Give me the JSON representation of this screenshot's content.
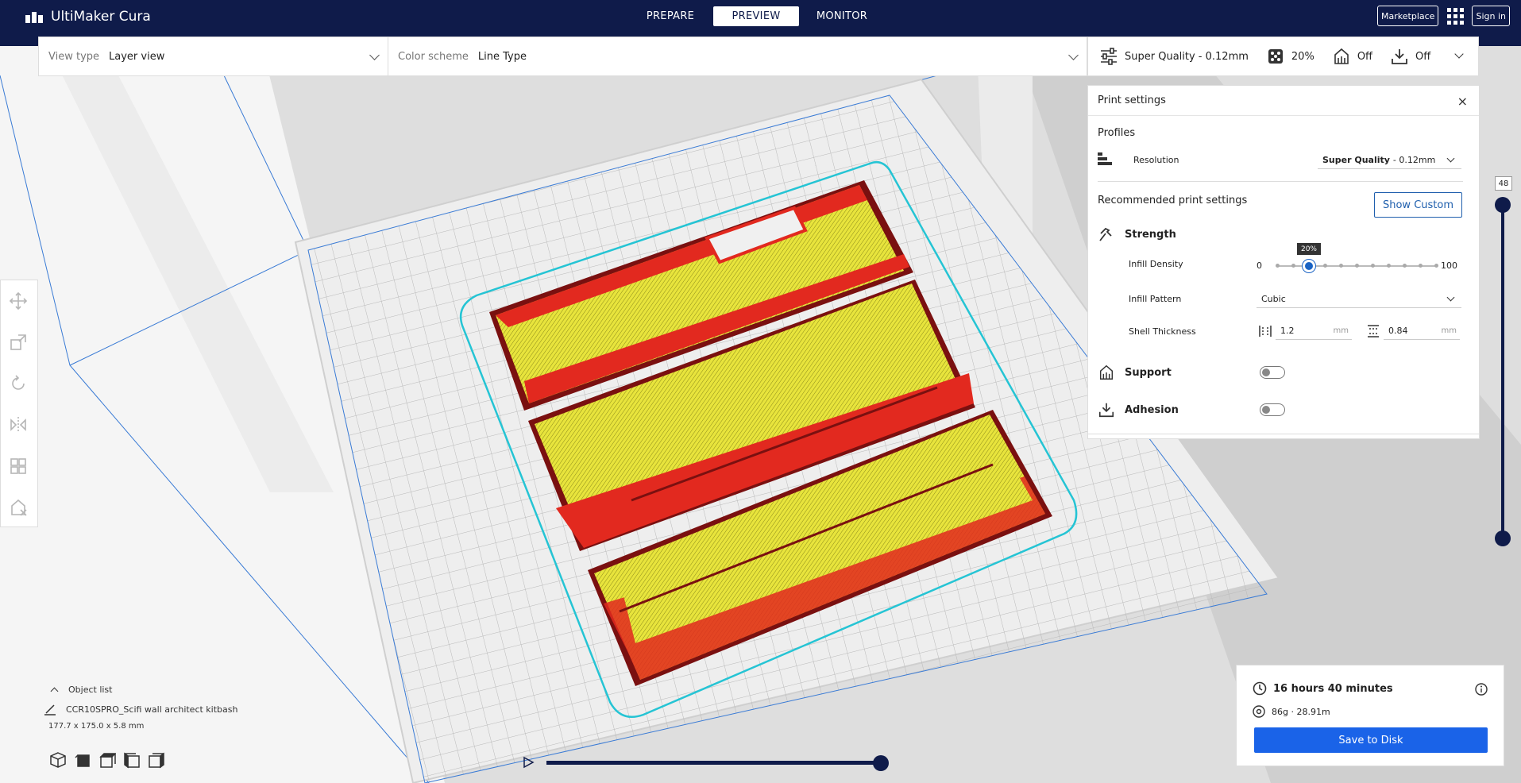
{
  "app": {
    "title": "UltiMaker Cura"
  },
  "stages": [
    {
      "label": "PREPARE",
      "active": false
    },
    {
      "label": "PREVIEW",
      "active": true
    },
    {
      "label": "MONITOR",
      "active": false
    }
  ],
  "header": {
    "marketplace": "Marketplace",
    "signin": "Sign in"
  },
  "view_toolbar": {
    "view_type_label": "View type",
    "view_type_value": "Layer view",
    "color_scheme_label": "Color scheme",
    "color_scheme_value": "Line Type"
  },
  "quality_bar": {
    "profile": "Super Quality - 0.12mm",
    "infill": "20%",
    "support": "Off",
    "adhesion": "Off"
  },
  "print_settings": {
    "title": "Print settings",
    "profiles_title": "Profiles",
    "resolution_label": "Resolution",
    "resolution_bold": "Super Quality",
    "resolution_rest": "- 0.12mm",
    "recommended_title": "Recommended print settings",
    "show_custom": "Show Custom",
    "strength": "Strength",
    "infill_density_label": "Infill Density",
    "infill_min": "0",
    "infill_max": "100",
    "infill_value": "20%",
    "infill_fraction": 0.2,
    "infill_pattern_label": "Infill Pattern",
    "infill_pattern_value": "Cubic",
    "shell_thickness_label": "Shell Thickness",
    "wall_value": "1.2",
    "top_bottom_value": "0.84",
    "unit": "mm",
    "support": "Support",
    "support_on": false,
    "adhesion": "Adhesion",
    "adhesion_on": false
  },
  "layer_slider": {
    "current_layer": "48"
  },
  "object_list": {
    "toggle_label": "Object list",
    "object_name": "CCR10SPRO_Scifi wall architect kitbash",
    "dimensions": "177.7 x 175.0 x 5.8 mm"
  },
  "estimate": {
    "time": "16 hours 40 minutes",
    "material": "86g · 28.91m",
    "save_label": "Save to Disk"
  },
  "colors": {
    "header_bg": "#0f1b4a",
    "accent": "#1a63e8",
    "infill_yellow": "#e8e43c",
    "wall_red": "#e2291f",
    "skirt_cyan": "#25c4d4"
  }
}
